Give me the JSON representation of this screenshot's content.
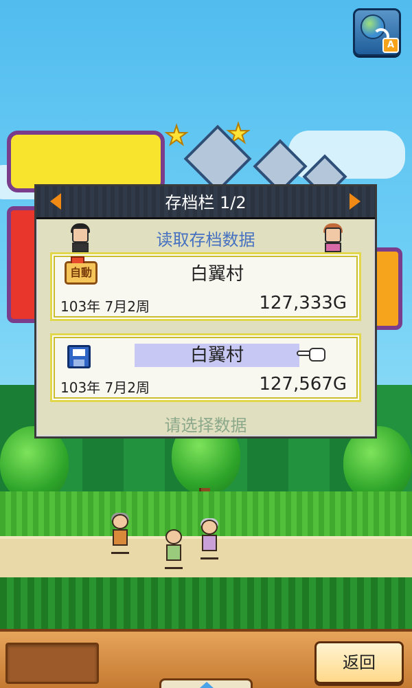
{
  "dialog": {
    "title": "存档栏 1/2",
    "subtitle": "读取存档数据",
    "prompt": "请选择数据",
    "slots": [
      {
        "icon": "auto-save-icon",
        "auto_label": "自動",
        "village": "白翼村",
        "date": "103年 7月2周",
        "gold": "127,333G",
        "selected": false
      },
      {
        "icon": "floppy-disk-icon",
        "village": "白翼村",
        "date": "103年 7月2周",
        "gold": "127,567G",
        "selected": true
      }
    ]
  },
  "lang_button": {
    "badge": "A",
    "icon": "language-switch-icon"
  },
  "bottom_bar": {
    "back_label": "返回"
  },
  "colors": {
    "subtitle": "#4670c0",
    "prompt": "#8ba88a",
    "accent_arrow": "#f08a14",
    "selected_row": "#c8c8f4"
  }
}
